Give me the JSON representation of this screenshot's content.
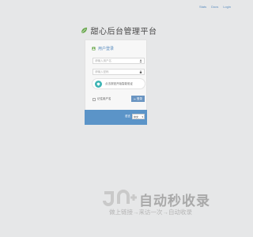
{
  "top_links": [
    "Stats",
    "Docs",
    "Login"
  ],
  "brand": {
    "title": "甜心后台管理平台",
    "leaf_color": "#6aa84f"
  },
  "login": {
    "title": "用户登录",
    "username_placeholder": "请输入用户名",
    "password_placeholder": "请输入密码",
    "captcha_text": "点击按钮开始智能验证",
    "remember_label": "记住用户名",
    "login_button": "登录"
  },
  "language": {
    "label": "语言",
    "selected": "中文"
  },
  "watermark": {
    "title": "自动秒收录",
    "subtitle": "做上链接→来访一次→自动收录"
  },
  "colors": {
    "accent": "#5b94c8",
    "button": "#6a95c2",
    "captcha": "#3db4b4",
    "background": "#e6e7e8"
  }
}
